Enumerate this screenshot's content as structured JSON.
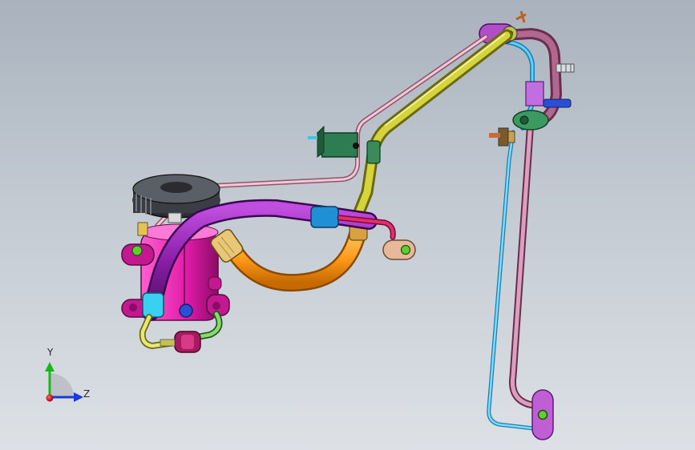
{
  "viewport": {
    "triad": {
      "y_label": "Y",
      "z_label": "Z",
      "colors": {
        "y_axis": "#18b818",
        "z_axis": "#1a3bd6",
        "x_axis": "#d81818"
      }
    }
  },
  "model": {
    "colors": {
      "purple_hose": "#8a1fa8",
      "orange_hose": "#ff9a1a",
      "olive_pipe": "#c4c030",
      "pink_pipe": "#f2b6cf",
      "blue_pipe": "#38c6ff",
      "mauve_pipe": "#a8567e",
      "compressor_body": "#e01aa8",
      "bracket_green": "#2e7d52",
      "ferrule_blue": "#1f8fd6",
      "pulley": "#3a3d44"
    }
  }
}
